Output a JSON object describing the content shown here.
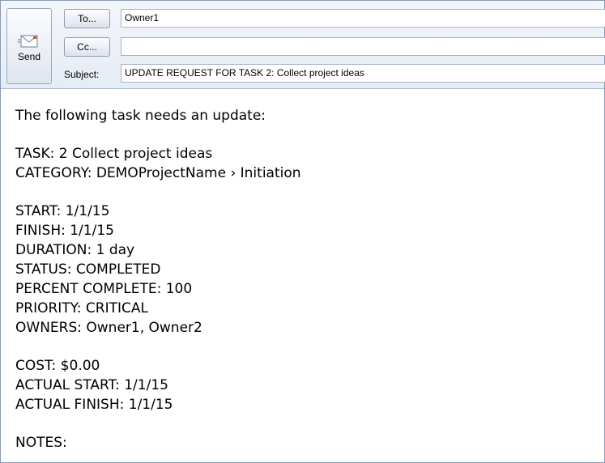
{
  "header": {
    "send_label": "Send",
    "to_label": "To...",
    "cc_label": "Cc...",
    "subject_label": "Subject:",
    "to_value": "Owner1",
    "cc_value": "",
    "subject_value": "UPDATE REQUEST FOR TASK 2: Collect project ideas"
  },
  "body": {
    "intro": "The following task needs an update:",
    "task": "TASK: 2 Collect project ideas",
    "category": "CATEGORY: DEMOProjectName › Initiation",
    "start": "START: 1/1/15",
    "finish": "FINISH: 1/1/15",
    "duration": "DURATION: 1 day",
    "status": "STATUS: COMPLETED",
    "percent_complete": "PERCENT COMPLETE: 100",
    "priority": "PRIORITY: CRITICAL",
    "owners": "OWNERS: Owner1, Owner2",
    "cost": "COST: $0.00",
    "actual_start": "ACTUAL START: 1/1/15",
    "actual_finish": "ACTUAL FINISH: 1/1/15",
    "notes": "NOTES:"
  },
  "icons": {
    "send": "send-mail-icon"
  }
}
